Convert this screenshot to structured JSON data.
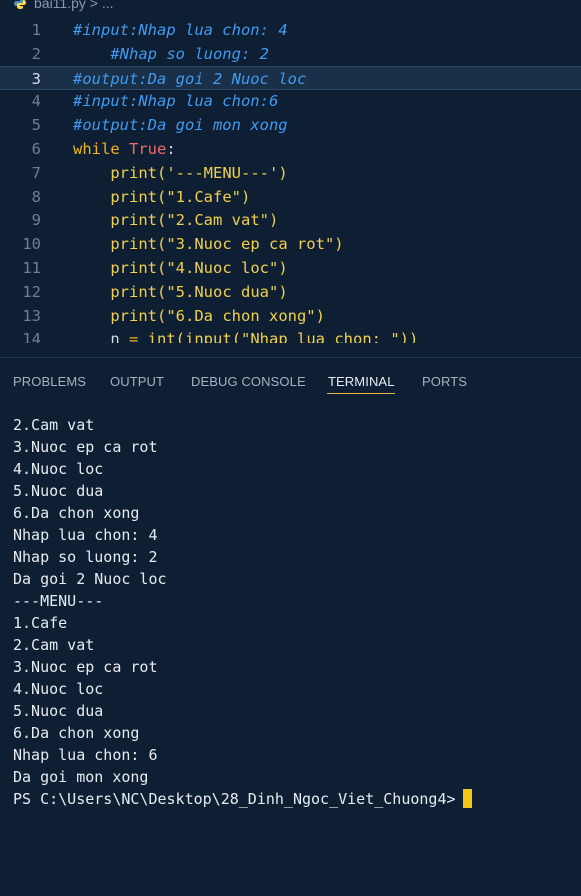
{
  "breadcrumb": {
    "filename": "bai11.py",
    "separator": "> ..."
  },
  "editor": {
    "lines": [
      {
        "num": "1",
        "tokens": [
          {
            "t": "#input:Nhap lua chon: 4",
            "c": "cm"
          }
        ]
      },
      {
        "num": "2",
        "tokens": [
          {
            "t": "    #Nhap so luong: 2",
            "c": "cm"
          }
        ]
      },
      {
        "num": "3",
        "tokens": [
          {
            "t": "#output:Da goi 2 Nuoc loc",
            "c": "cm"
          }
        ]
      },
      {
        "num": "4",
        "tokens": [
          {
            "t": "#input:Nhap lua chon:6",
            "c": "cm"
          }
        ]
      },
      {
        "num": "5",
        "tokens": [
          {
            "t": "#output:Da goi mon xong",
            "c": "cm"
          }
        ]
      },
      {
        "num": "6",
        "tokens": [
          {
            "t": "while ",
            "c": "kw"
          },
          {
            "t": "True",
            "c": "tr"
          },
          {
            "t": ":",
            "c": "id"
          }
        ]
      },
      {
        "num": "7",
        "tokens": [
          {
            "t": "    ",
            "c": "id"
          },
          {
            "t": "print",
            "c": "fn"
          },
          {
            "t": "('---MENU---')",
            "c": "st"
          }
        ]
      },
      {
        "num": "8",
        "tokens": [
          {
            "t": "    ",
            "c": "id"
          },
          {
            "t": "print",
            "c": "fn"
          },
          {
            "t": "(\"1.Cafe\")",
            "c": "st"
          }
        ]
      },
      {
        "num": "9",
        "tokens": [
          {
            "t": "    ",
            "c": "id"
          },
          {
            "t": "print",
            "c": "fn"
          },
          {
            "t": "(\"2.Cam vat\")",
            "c": "st"
          }
        ]
      },
      {
        "num": "10",
        "tokens": [
          {
            "t": "    ",
            "c": "id"
          },
          {
            "t": "print",
            "c": "fn"
          },
          {
            "t": "(\"3.Nuoc ep ca rot\")",
            "c": "st"
          }
        ]
      },
      {
        "num": "11",
        "tokens": [
          {
            "t": "    ",
            "c": "id"
          },
          {
            "t": "print",
            "c": "fn"
          },
          {
            "t": "(\"4.Nuoc loc\")",
            "c": "st"
          }
        ]
      },
      {
        "num": "12",
        "tokens": [
          {
            "t": "    ",
            "c": "id"
          },
          {
            "t": "print",
            "c": "fn"
          },
          {
            "t": "(\"5.Nuoc dua\")",
            "c": "st"
          }
        ]
      },
      {
        "num": "13",
        "tokens": [
          {
            "t": "    ",
            "c": "id"
          },
          {
            "t": "print",
            "c": "fn"
          },
          {
            "t": "(\"6.Da chon xong\")",
            "c": "st"
          }
        ]
      },
      {
        "num": "14",
        "tokens": [
          {
            "t": "    n ",
            "c": "id"
          },
          {
            "t": "= ",
            "c": "kw"
          },
          {
            "t": "int",
            "c": "fn"
          },
          {
            "t": "(",
            "c": "st"
          },
          {
            "t": "input",
            "c": "fn"
          },
          {
            "t": "(\"Nhap lua chon: \"))",
            "c": "st"
          }
        ]
      }
    ]
  },
  "panel": {
    "tabs": [
      {
        "label": "PROBLEMS"
      },
      {
        "label": "OUTPUT"
      },
      {
        "label": "DEBUG CONSOLE"
      },
      {
        "label": "TERMINAL"
      },
      {
        "label": "PORTS"
      }
    ],
    "active_tab": "TERMINAL"
  },
  "terminal": {
    "lines": [
      "2.Cam vat",
      "3.Nuoc ep ca rot",
      "4.Nuoc loc",
      "5.Nuoc dua",
      "6.Da chon xong",
      "Nhap lua chon: 4",
      "Nhap so luong: 2",
      "Da goi 2 Nuoc loc",
      "---MENU---",
      "1.Cafe",
      "2.Cam vat",
      "3.Nuoc ep ca rot",
      "4.Nuoc loc",
      "5.Nuoc dua",
      "6.Da chon xong",
      "Nhap lua chon: 6",
      "Da goi mon xong",
      "PS C:\\Users\\NC\\Desktop\\28_Dinh_Ngoc_Viet_Chuong4>"
    ]
  }
}
